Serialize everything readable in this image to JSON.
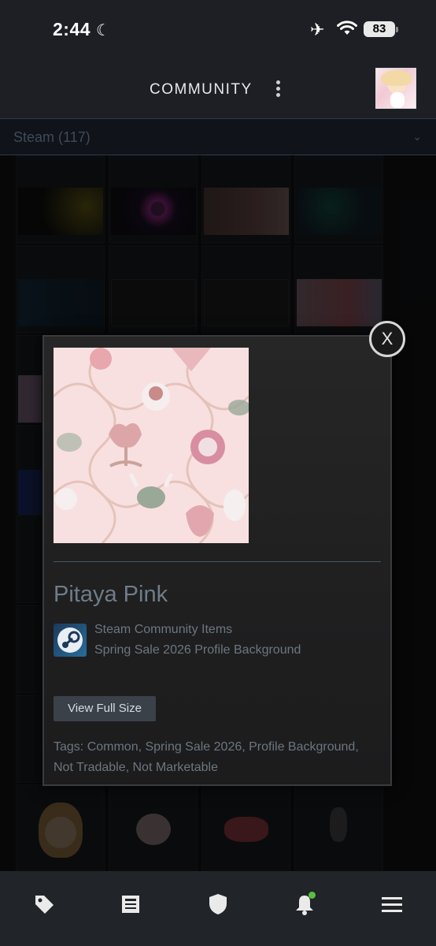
{
  "status_bar": {
    "time": "2:44",
    "battery": "83"
  },
  "header": {
    "title": "COMMUNITY"
  },
  "filter": {
    "label": "Steam (117)"
  },
  "modal": {
    "item_name": "Pitaya Pink",
    "game_line": "Steam Community Items",
    "type_line": "Spring Sale 2026 Profile Background",
    "view_button": "View Full Size",
    "tags": "Tags: Common, Spring Sale 2026, Profile Background, Not Tradable, Not Marketable",
    "close_label": "X"
  },
  "colors": {
    "accent_green": "#59bf40",
    "background": "#1d1f24"
  },
  "icons": {
    "nav": [
      "tag-icon",
      "news-icon",
      "shield-icon",
      "bell-icon",
      "menu-icon"
    ]
  }
}
